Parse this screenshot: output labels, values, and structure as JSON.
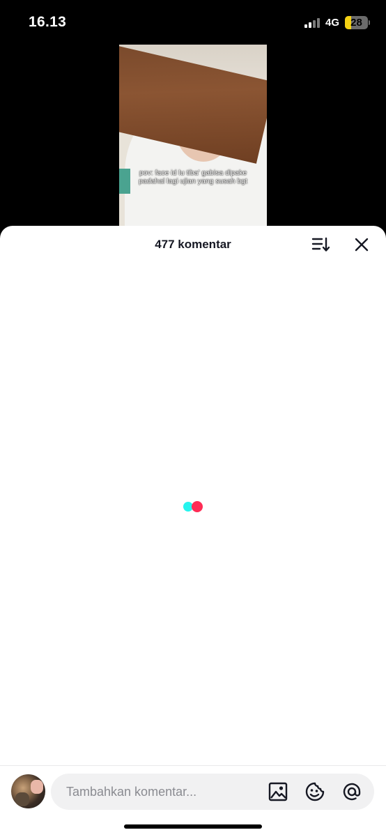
{
  "status_bar": {
    "time": "16.13",
    "network": "4G",
    "battery": "28"
  },
  "video": {
    "caption": "pov: face id lu tiba' gabisa dipake padahal lagi ujian yang susah bgt"
  },
  "comments_sheet": {
    "title": "477 komentar",
    "loading_colors": [
      "#25f4ee",
      "#fe2c55"
    ]
  },
  "input_bar": {
    "placeholder": "Tambahkan komentar...",
    "icons": [
      "image-icon",
      "emoji-icon",
      "mention-icon"
    ]
  }
}
